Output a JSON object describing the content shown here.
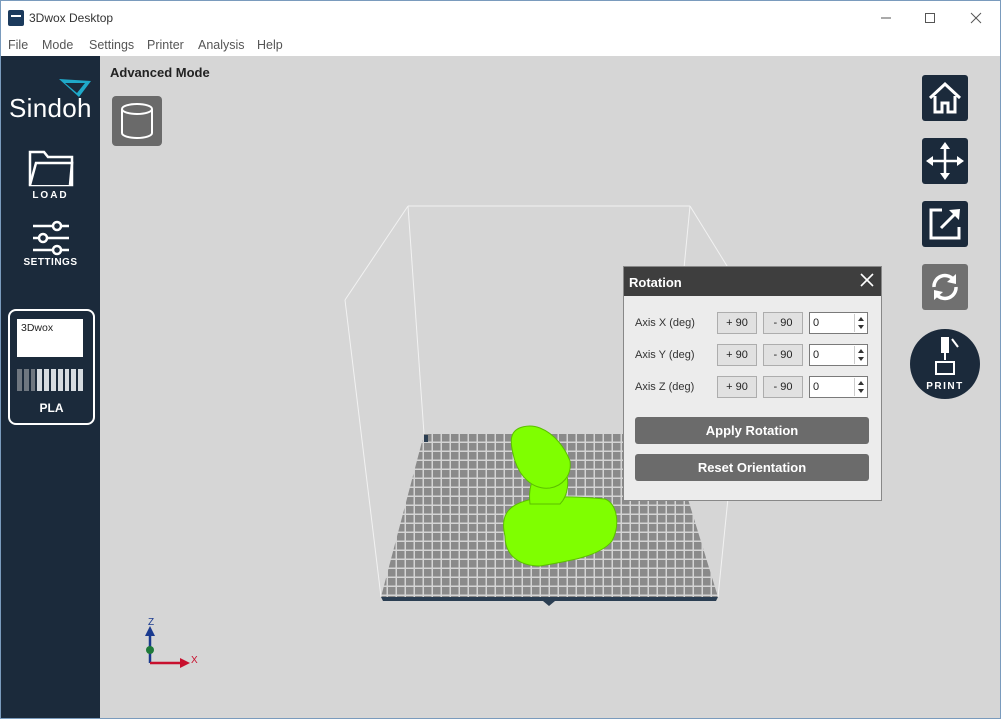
{
  "window": {
    "title": "3Dwox Desktop",
    "min_icon": "minimize-icon",
    "max_icon": "maximize-icon",
    "close_icon": "close-icon"
  },
  "menu": [
    "File",
    "Mode",
    "Settings",
    "Printer",
    "Analysis",
    "Help"
  ],
  "sidebar": {
    "logo": "Sindoh",
    "load_label": "LOAD",
    "settings_label": "SETTINGS",
    "material": {
      "printer": "3Dwox",
      "name": "PLA",
      "filament_level": 0.3
    }
  },
  "viewport": {
    "mode": "Advanced Mode",
    "axis_x": "X",
    "axis_z": "Z",
    "model_color": "#7fff00"
  },
  "tools": {
    "home": "home-icon",
    "move": "move-icon",
    "scale": "scale-icon",
    "rotate": "rotate-icon",
    "print_label": "PRINT"
  },
  "rotation": {
    "title": "Rotation",
    "axes": [
      {
        "label": "Axis X (deg)",
        "plus": "+ 90",
        "minus": "- 90",
        "value": "0"
      },
      {
        "label": "Axis Y (deg)",
        "plus": "+ 90",
        "minus": "- 90",
        "value": "0"
      },
      {
        "label": "Axis Z (deg)",
        "plus": "+ 90",
        "minus": "- 90",
        "value": "0"
      }
    ],
    "apply_label": "Apply Rotation",
    "reset_label": "Reset Orientation"
  },
  "colors": {
    "sidebar": "#1b2a3b",
    "viewport": "#d6d6d6",
    "accent_model": "#7fff00"
  }
}
